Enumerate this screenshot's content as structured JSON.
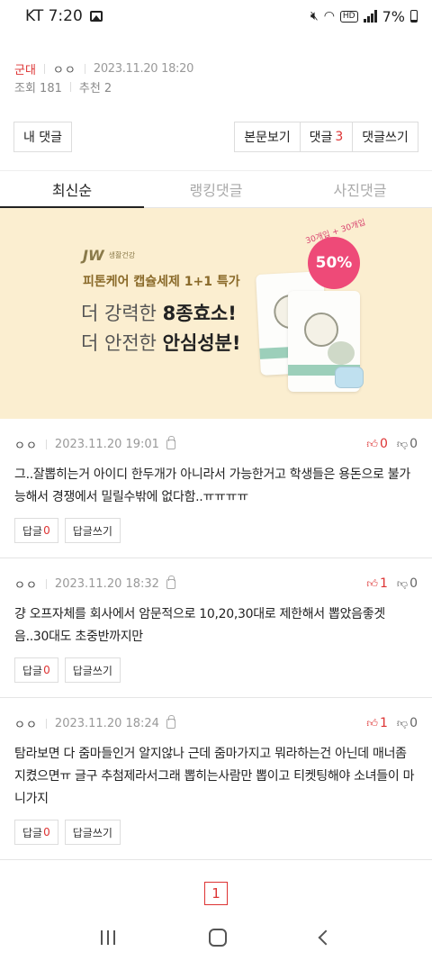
{
  "status_bar": {
    "carrier_time": "KT 7:20",
    "hd": "HD",
    "battery": "7%"
  },
  "post": {
    "category": "군대",
    "author": "ㅇㅇ",
    "date": "2023.11.20 18:20",
    "views_label": "조회 181",
    "recommend_label": "추천 2"
  },
  "actions": {
    "my_comments": "내 댓글",
    "view_body": "본문보기",
    "comments_label": "댓글",
    "comments_count": "3",
    "write_comment": "댓글쓰기"
  },
  "tabs": [
    {
      "label": "최신순",
      "active": true
    },
    {
      "label": "랭킹댓글",
      "active": false
    },
    {
      "label": "사진댓글",
      "active": false
    }
  ],
  "ad": {
    "logo_mark": "JW",
    "logo_text": "생활건강",
    "line1": "피톤케어 캡슐세제 1+1 특가",
    "line2_prefix": "더 강력한 ",
    "line2_bold": "8종효소!",
    "line3_prefix": "더 안전한 ",
    "line3_bold": "안심성분!",
    "badge_arc": "30개입 + 30개입",
    "badge": "50%"
  },
  "comments": [
    {
      "author": "ㅇㅇ",
      "date": "2023.11.20 19:01",
      "up": "0",
      "down": "0",
      "body": "그..잘뽑히는거 아이디 한두개가 아니라서 가능한거고 학생들은 용돈으로 불가능해서 경쟁에서 밀릴수밖에 없다함..ㅠㅠㅠㅠ",
      "reply_label": "답글",
      "reply_count": "0",
      "write_reply": "답글쓰기"
    },
    {
      "author": "ㅇㅇ",
      "date": "2023.11.20 18:32",
      "up": "1",
      "down": "0",
      "body": "걍 오프자체를 회사에서 암문적으로 10,20,30대로 제한해서 뽑았음좋겟음..30대도 초중반까지만",
      "reply_label": "답글",
      "reply_count": "0",
      "write_reply": "답글쓰기"
    },
    {
      "author": "ㅇㅇ",
      "date": "2023.11.20 18:24",
      "up": "1",
      "down": "0",
      "body": "탐라보면 다 줌마들인거 알지않나 근데 줌마가지고 뭐라하는건 아닌데 매너좀 지켰으면ㅠ 글구 추첨제라서그래 뽑히는사람만 뽑이고 티켓팅해야 소녀들이 마니가지",
      "reply_label": "답글",
      "reply_count": "0",
      "write_reply": "답글쓰기"
    }
  ],
  "pagination": {
    "current": "1"
  }
}
